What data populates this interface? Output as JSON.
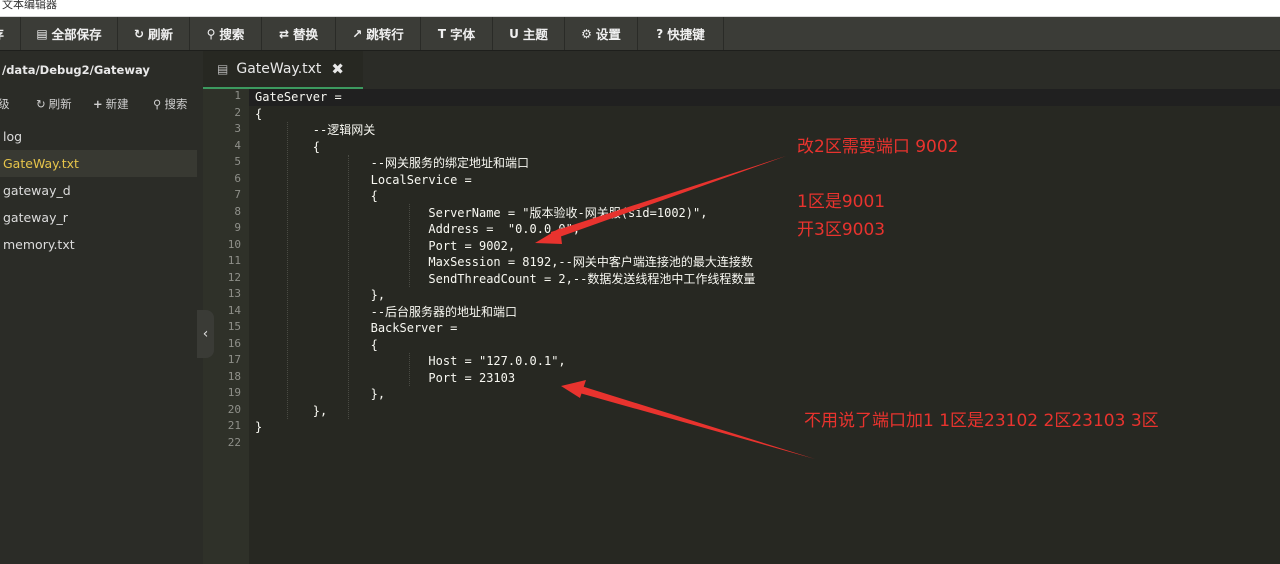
{
  "titlebar": {
    "text": "文本编辑器"
  },
  "toolbar": {
    "items": [
      {
        "icon": "save-icon",
        "glyph": "▣",
        "label": "存"
      },
      {
        "icon": "save-all-icon",
        "glyph": "▤",
        "label": "全部保存"
      },
      {
        "icon": "refresh-icon",
        "glyph": "↻",
        "label": "刷新"
      },
      {
        "icon": "search-icon",
        "glyph": "⚲",
        "label": "搜索"
      },
      {
        "icon": "replace-icon",
        "glyph": "⇄",
        "label": "替换"
      },
      {
        "icon": "goto-line-icon",
        "glyph": "↗",
        "label": "跳转行"
      },
      {
        "icon": "font-icon",
        "glyph": "T",
        "label": "字体"
      },
      {
        "icon": "theme-icon",
        "glyph": "U",
        "label": "主题"
      },
      {
        "icon": "gear-icon",
        "glyph": "⚙",
        "label": "设置"
      },
      {
        "icon": "help-icon",
        "glyph": "?",
        "label": "快捷键"
      }
    ]
  },
  "sidebar": {
    "path": "/data/Debug2/Gateway",
    "tools": [
      {
        "icon": "up-level-icon",
        "glyph": "",
        "label": "级"
      },
      {
        "icon": "refresh-icon",
        "glyph": "↻",
        "label": "刷新"
      },
      {
        "icon": "plus-icon",
        "glyph": "+",
        "label": "新建"
      },
      {
        "icon": "search-icon",
        "glyph": "⚲",
        "label": "搜索"
      }
    ],
    "files": [
      "log",
      "GateWay.txt",
      "gateway_d",
      "gateway_r",
      "memory.txt"
    ],
    "active_file": "GateWay.txt",
    "collapse_glyph": "‹"
  },
  "tab": {
    "doc_glyph": "▤",
    "name": "GateWay.txt",
    "close_glyph": "✖"
  },
  "editor": {
    "lines": [
      "GateServer =",
      "{",
      "        --逻辑网关",
      "        {",
      "                --网关服务的绑定地址和端口",
      "                LocalService =",
      "                {",
      "                        ServerName = \"版本验收-网关服(sid=1002)\",",
      "                        Address =  \"0.0.0.0\",",
      "                        Port = 9002,",
      "                        MaxSession = 8192,--网关中客户端连接池的最大连接数",
      "                        SendThreadCount = 2,--数据发送线程池中工作线程数量",
      "                },",
      "                --后台服务器的地址和端口",
      "                BackServer =",
      "                {",
      "                        Host = \"127.0.0.1\",",
      "                        Port = 23103",
      "                },",
      "        },",
      "}",
      ""
    ]
  },
  "annotations": {
    "a1": "改2区需要端口 9002",
    "a2": "1区是9001",
    "a3": "开3区9003",
    "a4": "不用说了端口加1  1区是23102 2区23103  3区"
  },
  "colors": {
    "annotation": "#e8332e",
    "active_file": "#e6c44a",
    "tab_underline": "#3c9a5f"
  }
}
